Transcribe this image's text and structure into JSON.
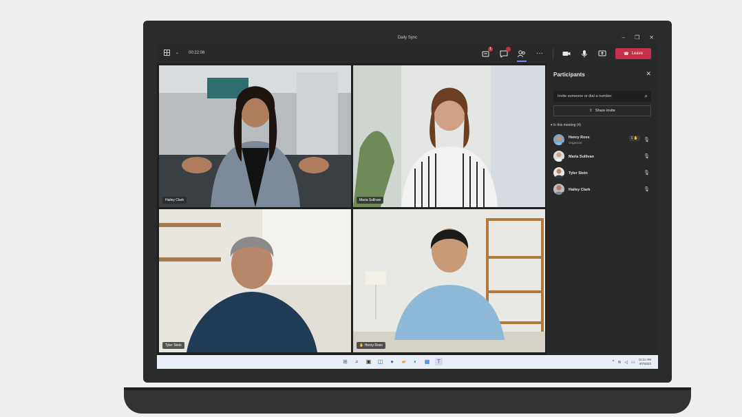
{
  "window": {
    "title": "Daily Sync",
    "minimize_glyph": "–",
    "maximize_glyph": "❐",
    "close_glyph": "✕"
  },
  "toolbar": {
    "timer": "00:22:06",
    "notification_count": "1",
    "leave_label": "Leave",
    "more_glyph": "···"
  },
  "tiles": [
    {
      "name": "Hailey Clark",
      "state": "speaking"
    },
    {
      "name": "Maria Sullivan",
      "state": "normal"
    },
    {
      "name": "Tyler Stein",
      "state": "normal"
    },
    {
      "name": "Henry Ross",
      "state": "hand-raised"
    }
  ],
  "participants": {
    "title": "Participants",
    "invite_placeholder": "Invite someone or dial a number",
    "share_invite_label": "Share invite",
    "section_label": "In this meeting (4)",
    "items": [
      {
        "name": "Henry Ross",
        "role": "Organizer",
        "hand_count": "1"
      },
      {
        "name": "Maria Sullivan",
        "role": ""
      },
      {
        "name": "Tyler Stein",
        "role": ""
      },
      {
        "name": "Hailey Clark",
        "role": ""
      }
    ]
  },
  "taskbar": {
    "time": "11:11 AM",
    "date": "4/7/2022"
  },
  "colors": {
    "accent": "#7f85f5",
    "leave": "#c4314b",
    "speaking_border": "#8b8cc7",
    "raised_border": "#e6a13a",
    "presence_available": "#6bb700"
  }
}
